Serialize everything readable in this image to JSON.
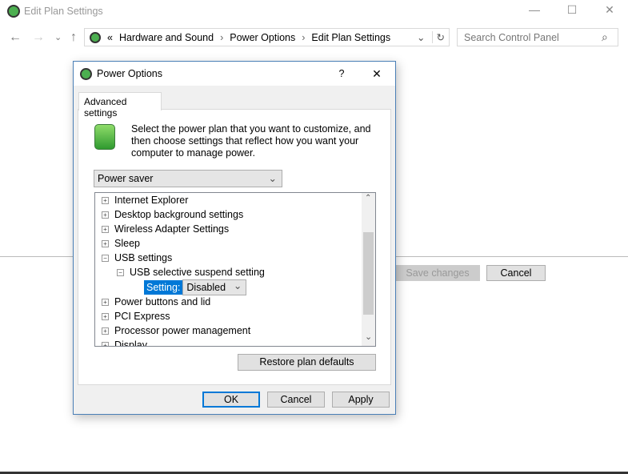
{
  "window": {
    "title": "Edit Plan Settings",
    "minimize": "—",
    "maximize": "☐",
    "close": "✕"
  },
  "nav": {
    "back": "←",
    "forward": "→",
    "recent": "⌄",
    "up": "↑"
  },
  "address": {
    "overflow": "«",
    "crumbs": [
      "Hardware and Sound",
      "Power Options",
      "Edit Plan Settings"
    ],
    "sep": "›",
    "dropdown": "⌄",
    "refresh": "↻"
  },
  "search": {
    "placeholder": "Search Control Panel",
    "icon": "⌕"
  },
  "background_buttons": {
    "save": "Save changes",
    "cancel": "Cancel"
  },
  "dialog": {
    "title": "Power Options",
    "help": "?",
    "close": "✕",
    "tab": "Advanced settings",
    "description": "Select the power plan that you want to customize, and then choose settings that reflect how you want your computer to manage power.",
    "plan": "Power saver",
    "tree": [
      {
        "label": "Internet Explorer",
        "toggle": "+"
      },
      {
        "label": "Desktop background settings",
        "toggle": "+"
      },
      {
        "label": "Wireless Adapter Settings",
        "toggle": "+"
      },
      {
        "label": "Sleep",
        "toggle": "+"
      },
      {
        "label": "USB settings",
        "toggle": "−"
      },
      {
        "label": "USB selective suspend setting",
        "toggle": "−"
      },
      {
        "label": "Setting:",
        "value": "Disabled"
      },
      {
        "label": "Power buttons and lid",
        "toggle": "+"
      },
      {
        "label": "PCI Express",
        "toggle": "+"
      },
      {
        "label": "Processor power management",
        "toggle": "+"
      },
      {
        "label": "Display",
        "toggle": "+"
      }
    ],
    "restore": "Restore plan defaults",
    "ok": "OK",
    "cancel": "Cancel",
    "apply": "Apply"
  },
  "colors": {
    "accent": "#0078d7",
    "dialog_border": "#4a7fb6"
  }
}
